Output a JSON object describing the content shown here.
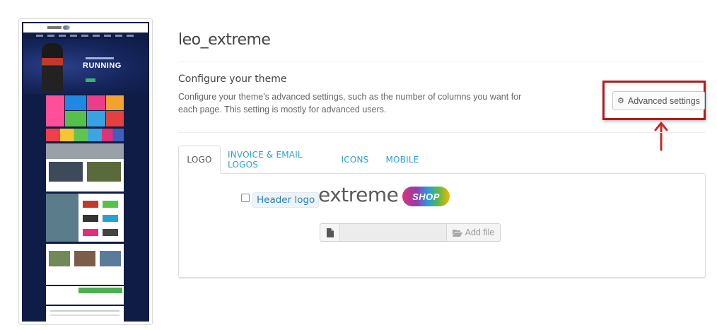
{
  "theme": {
    "name": "leo_extreme",
    "thumbnail": {
      "hero_text": "RUNNING"
    }
  },
  "configure": {
    "title": "Configure your theme",
    "description": "Configure your theme's advanced settings, such as the number of columns you want for each page. This setting is mostly for advanced users.",
    "advanced_button": "Advanced settings"
  },
  "tabs": [
    {
      "label": "LOGO",
      "active": true
    },
    {
      "label": "INVOICE & EMAIL LOGOS",
      "active": false
    },
    {
      "label": "ICONS",
      "active": false
    },
    {
      "label": "MOBILE",
      "active": false
    }
  ],
  "logo_panel": {
    "header_logo_label": "Header logo",
    "header_logo_checked": false,
    "logo_word": "extreme",
    "logo_badge": "SHOP",
    "file_value": "",
    "add_file_label": "Add file"
  },
  "colors": {
    "accent_link": "#2ca0d6",
    "highlight_border": "#b01c1c",
    "thumbnail_bg": "#0f1c45"
  }
}
